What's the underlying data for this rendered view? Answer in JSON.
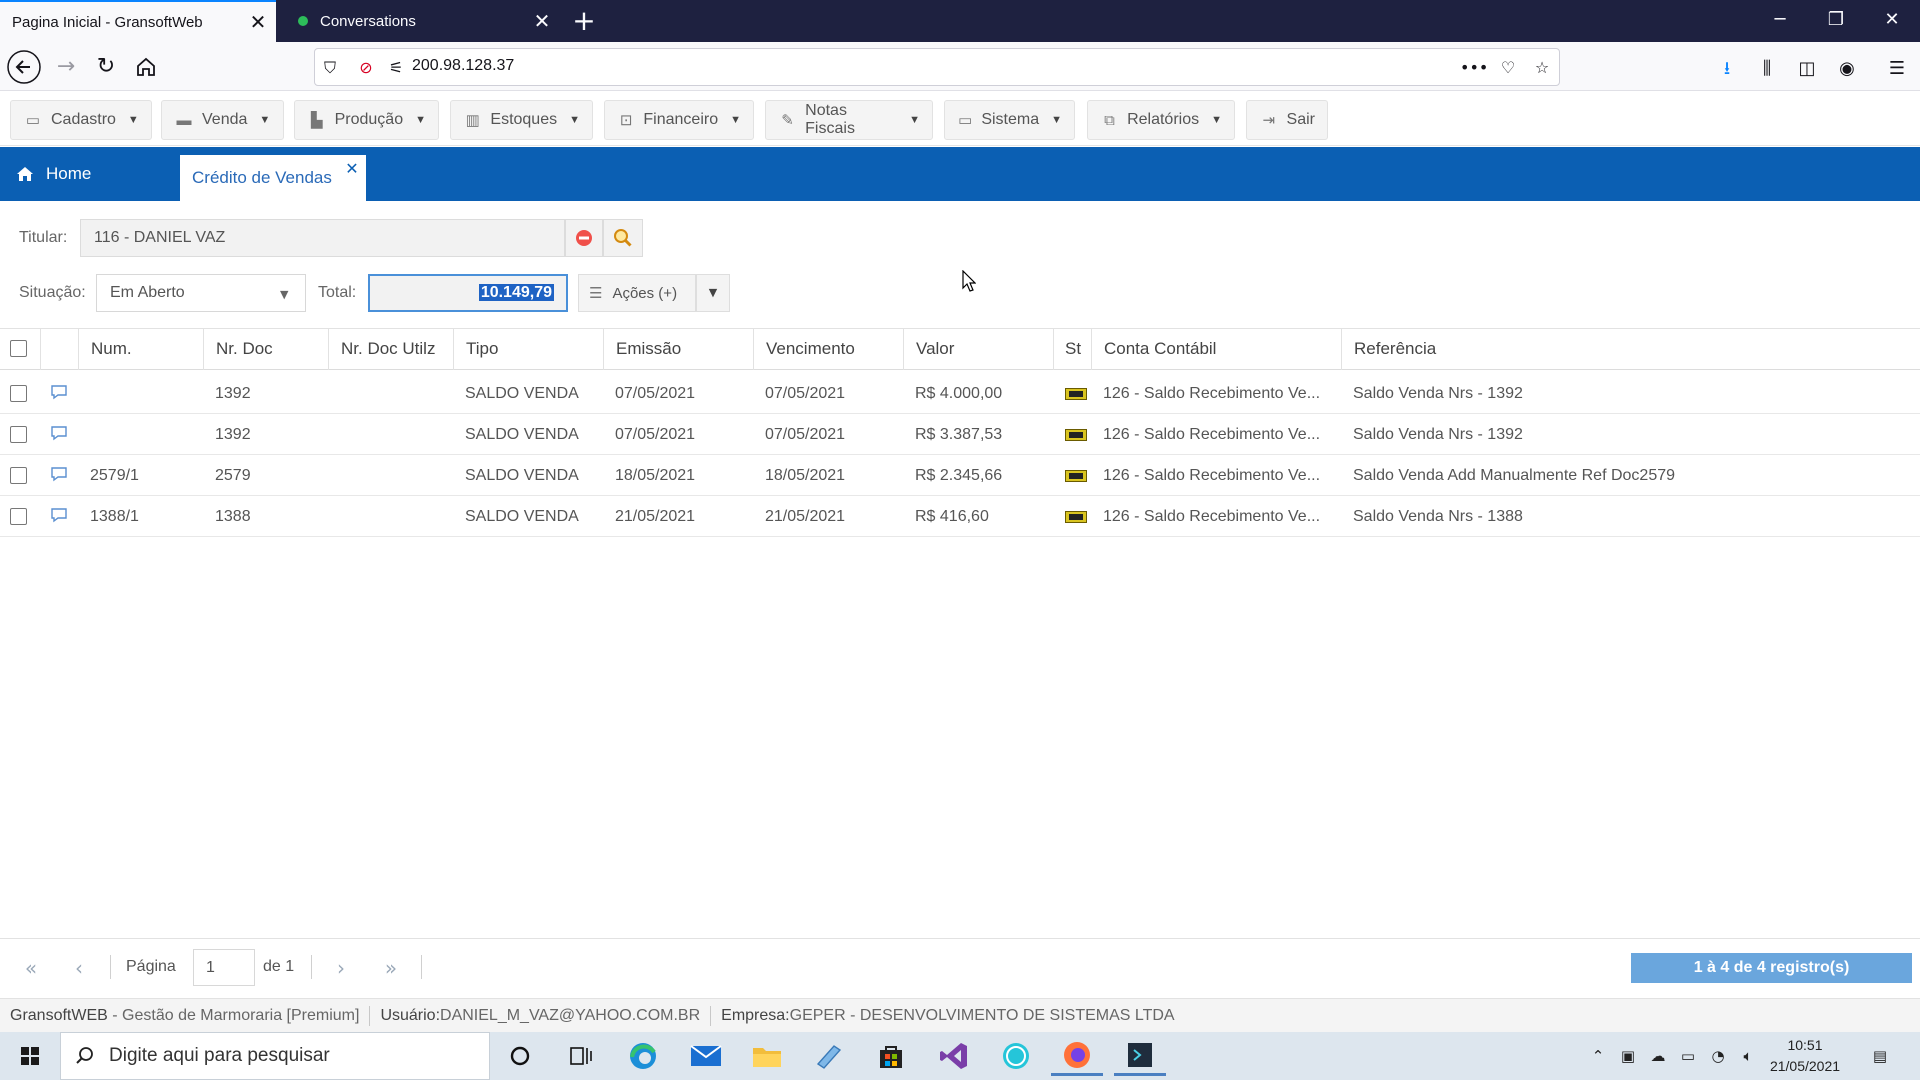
{
  "browser": {
    "tabs": [
      {
        "title": "Pagina Inicial - GransoftWeb",
        "active": true
      },
      {
        "title": "Conversations",
        "active": false
      }
    ],
    "url": "200.98.128.37"
  },
  "menu": [
    {
      "label": "Cadastro",
      "icon": "document-icon"
    },
    {
      "label": "Venda",
      "icon": "card-icon"
    },
    {
      "label": "Produção",
      "icon": "bar-chart-icon"
    },
    {
      "label": "Estoques",
      "icon": "barcode-icon"
    },
    {
      "label": "Financeiro",
      "icon": "money-icon"
    },
    {
      "label": "Notas Fiscais",
      "icon": "edit-icon"
    },
    {
      "label": "Sistema",
      "icon": "laptop-icon"
    },
    {
      "label": "Relatórios",
      "icon": "copy-icon"
    },
    {
      "label": "Sair",
      "icon": "sign-out-icon"
    }
  ],
  "app_tabs": {
    "home": "Home",
    "active": "Crédito de Vendas"
  },
  "form": {
    "titular_label": "Titular:",
    "titular_value": "116 - DANIEL VAZ",
    "situacao_label": "Situação:",
    "situacao_value": "Em Aberto",
    "total_label": "Total:",
    "total_value": "10.149,79",
    "acoes_label": "Ações (+)"
  },
  "table": {
    "columns": [
      "Num.",
      "Nr. Doc",
      "Nr. Doc Utilz",
      "Tipo",
      "Emissão",
      "Vencimento",
      "Valor",
      "St",
      "Conta Contábil",
      "Referência"
    ],
    "rows": [
      {
        "num": "",
        "nr_doc": "1392",
        "nr_doc_utilz": "",
        "tipo": "SALDO VENDA",
        "emissao": "07/05/2021",
        "vencimento": "07/05/2021",
        "valor": "R$ 4.000,00",
        "conta": "126 - Saldo Recebimento Ve...",
        "referencia": "Saldo Venda Nrs - 1392"
      },
      {
        "num": "",
        "nr_doc": "1392",
        "nr_doc_utilz": "",
        "tipo": "SALDO VENDA",
        "emissao": "07/05/2021",
        "vencimento": "07/05/2021",
        "valor": "R$ 3.387,53",
        "conta": "126 - Saldo Recebimento Ve...",
        "referencia": "Saldo Venda Nrs - 1392"
      },
      {
        "num": "2579/1",
        "nr_doc": "2579",
        "nr_doc_utilz": "",
        "tipo": "SALDO VENDA",
        "emissao": "18/05/2021",
        "vencimento": "18/05/2021",
        "valor": "R$ 2.345,66",
        "conta": "126 - Saldo Recebimento Ve...",
        "referencia": "Saldo Venda Add Manualmente Ref Doc2579"
      },
      {
        "num": "1388/1",
        "nr_doc": "1388",
        "nr_doc_utilz": "",
        "tipo": "SALDO VENDA",
        "emissao": "21/05/2021",
        "vencimento": "21/05/2021",
        "valor": "R$ 416,60",
        "conta": "126 - Saldo Recebimento Ve...",
        "referencia": "Saldo Venda Nrs - 1388"
      }
    ]
  },
  "pager": {
    "page_label": "Página",
    "page_value": "1",
    "of_label": "de 1",
    "records": "1 à 4 de 4 registro(s)"
  },
  "footer": {
    "app": "GransoftWEB",
    "app_desc": " - Gestão de Marmoraria [Premium]",
    "user_label": "Usuário:",
    "user_value": "DANIEL_M_VAZ@YAHOO.COM.BR",
    "company_label": "Empresa:",
    "company_value": "GEPER - DESENVOLVIMENTO DE SISTEMAS LTDA"
  },
  "taskbar": {
    "search_placeholder": "Digite aqui para pesquisar",
    "time": "10:51",
    "date": "21/05/2021"
  },
  "colors": {
    "accent_blue": "#0b5fb3",
    "titlebar": "#1e2140",
    "records_badge": "#6aa6dd"
  }
}
